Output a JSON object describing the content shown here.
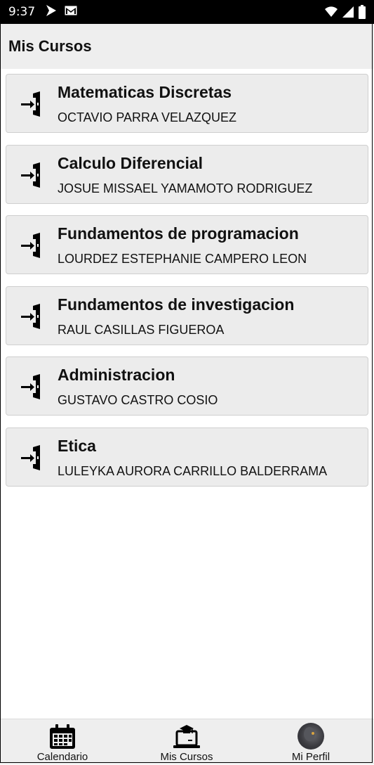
{
  "status_bar": {
    "time": "9:37",
    "icons_left": [
      "navigation-arrow-icon",
      "gmail-icon"
    ],
    "icons_right": [
      "wifi-icon",
      "signal-icon",
      "battery-icon"
    ]
  },
  "app_bar": {
    "title": "Mis Cursos"
  },
  "courses": [
    {
      "title": "Matematicas Discretas",
      "teacher": "OCTAVIO PARRA VELAZQUEZ"
    },
    {
      "title": "Calculo Diferencial",
      "teacher": "JOSUE MISSAEL YAMAMOTO RODRIGUEZ"
    },
    {
      "title": "Fundamentos de programacion",
      "teacher": "LOURDEZ ESTEPHANIE CAMPERO LEON"
    },
    {
      "title": "Fundamentos de investigacion",
      "teacher": "RAUL CASILLAS FIGUEROA"
    },
    {
      "title": "Administracion",
      "teacher": "GUSTAVO CASTRO COSIO"
    },
    {
      "title": "Etica",
      "teacher": "LULEYKA AURORA CARRILLO BALDERRAMA"
    }
  ],
  "bottom_nav": {
    "items": [
      {
        "label": "Calendario",
        "icon": "calendar-icon"
      },
      {
        "label": "Mis Cursos",
        "icon": "course-laptop-icon"
      },
      {
        "label": "Mi Perfil",
        "icon": "profile-avatar"
      }
    ]
  },
  "colors": {
    "status_bar_bg": "#000000",
    "app_bar_bg": "#eeeeee",
    "card_bg": "#ececec",
    "nav_bg": "#eeeeee"
  }
}
